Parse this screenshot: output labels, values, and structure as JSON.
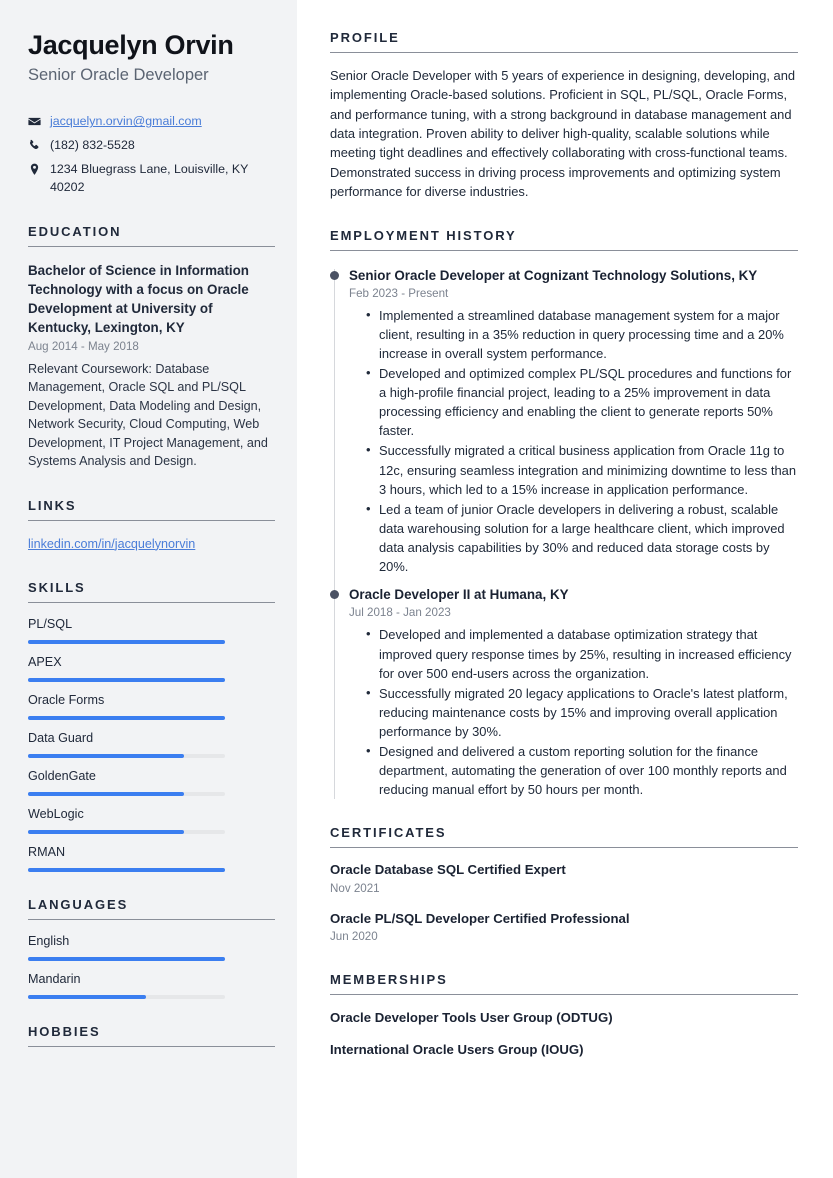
{
  "sidebar": {
    "name": "Jacquelyn Orvin",
    "job_title": "Senior Oracle Developer",
    "contact": {
      "email": "jacquelyn.orvin@gmail.com",
      "phone": "(182) 832-5528",
      "address": "1234 Bluegrass Lane, Louisville, KY 40202"
    },
    "education": {
      "heading": "EDUCATION",
      "degree": "Bachelor of Science in Information Technology with a focus on Oracle Development at University of Kentucky, Lexington, KY",
      "date": "Aug 2014 - May 2018",
      "description": "Relevant Coursework: Database Management, Oracle SQL and PL/SQL Development, Data Modeling and Design, Network Security, Cloud Computing, Web Development, IT Project Management, and Systems Analysis and Design."
    },
    "links": {
      "heading": "LINKS",
      "items": [
        {
          "label": "linkedin.com/in/jacquelynorvin"
        }
      ]
    },
    "skills": {
      "heading": "SKILLS",
      "items": [
        {
          "label": "PL/SQL",
          "level": 100
        },
        {
          "label": "APEX",
          "level": 100
        },
        {
          "label": "Oracle Forms",
          "level": 100
        },
        {
          "label": "Data Guard",
          "level": 79
        },
        {
          "label": "GoldenGate",
          "level": 79
        },
        {
          "label": "WebLogic",
          "level": 79
        },
        {
          "label": "RMAN",
          "level": 100
        }
      ]
    },
    "languages": {
      "heading": "LANGUAGES",
      "items": [
        {
          "label": "English",
          "level": 100
        },
        {
          "label": "Mandarin",
          "level": 60
        }
      ]
    },
    "hobbies": {
      "heading": "HOBBIES"
    }
  },
  "main": {
    "profile": {
      "heading": "PROFILE",
      "text": "Senior Oracle Developer with 5 years of experience in designing, developing, and implementing Oracle-based solutions. Proficient in SQL, PL/SQL, Oracle Forms, and performance tuning, with a strong background in database management and data integration. Proven ability to deliver high-quality, scalable solutions while meeting tight deadlines and effectively collaborating with cross-functional teams. Demonstrated success in driving process improvements and optimizing system performance for diverse industries."
    },
    "employment": {
      "heading": "EMPLOYMENT HISTORY",
      "jobs": [
        {
          "title": "Senior Oracle Developer at Cognizant Technology Solutions, KY",
          "date": "Feb 2023 - Present",
          "bullets": [
            "Implemented a streamlined database management system for a major client, resulting in a 35% reduction in query processing time and a 20% increase in overall system performance.",
            "Developed and optimized complex PL/SQL procedures and functions for a high-profile financial project, leading to a 25% improvement in data processing efficiency and enabling the client to generate reports 50% faster.",
            "Successfully migrated a critical business application from Oracle 11g to 12c, ensuring seamless integration and minimizing downtime to less than 3 hours, which led to a 15% increase in application performance.",
            "Led a team of junior Oracle developers in delivering a robust, scalable data warehousing solution for a large healthcare client, which improved data analysis capabilities by 30% and reduced data storage costs by 20%."
          ]
        },
        {
          "title": "Oracle Developer II at Humana, KY",
          "date": "Jul 2018 - Jan 2023",
          "bullets": [
            "Developed and implemented a database optimization strategy that improved query response times by 25%, resulting in increased efficiency for over 500 end-users across the organization.",
            "Successfully migrated 20 legacy applications to Oracle's latest platform, reducing maintenance costs by 15% and improving overall application performance by 30%.",
            "Designed and delivered a custom reporting solution for the finance department, automating the generation of over 100 monthly reports and reducing manual effort by 50 hours per month."
          ]
        }
      ]
    },
    "certificates": {
      "heading": "CERTIFICATES",
      "items": [
        {
          "title": "Oracle Database SQL Certified Expert",
          "date": "Nov 2021"
        },
        {
          "title": "Oracle PL/SQL Developer Certified Professional",
          "date": "Jun 2020"
        }
      ]
    },
    "memberships": {
      "heading": "MEMBERSHIPS",
      "items": [
        {
          "title": "Oracle Developer Tools User Group (ODTUG)"
        },
        {
          "title": "International Oracle Users Group (IOUG)"
        }
      ]
    }
  },
  "colors": {
    "accent": "#3b7ef0",
    "link": "#4a7dd8",
    "sidebar_bg": "#f2f3f5",
    "heading": "#20293a",
    "muted": "#7c838f"
  }
}
